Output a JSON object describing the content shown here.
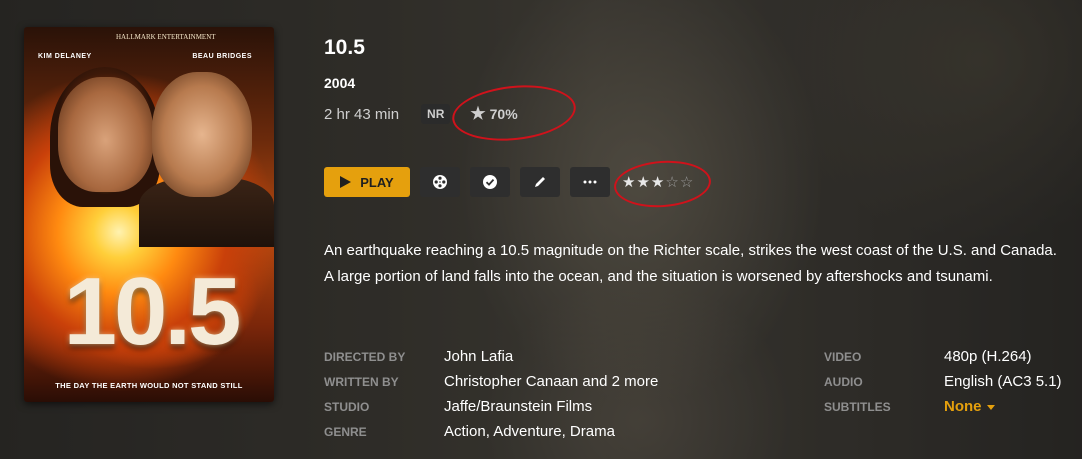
{
  "movie": {
    "title": "10.5",
    "year": "2004",
    "duration": "2 hr 43 min",
    "content_rating": "NR",
    "critic_rating": "70%",
    "user_rating_stars": 3,
    "user_rating_max": 5,
    "summary": "An earthquake reaching a 10.5 magnitude on the Richter scale, strikes the west coast of the U.S. and Canada. A large portion of land falls into the ocean, and the situation is worsened by aftershocks and tsunami."
  },
  "poster": {
    "studio": "HALLMARK ENTERTAINMENT",
    "actor_left": "KIM DELANEY",
    "actor_right": "BEAU BRIDGES",
    "title_art": "10.5",
    "tagline": "THE DAY THE EARTH WOULD NOT STAND STILL"
  },
  "actions": {
    "play_label": "PLAY",
    "icons": [
      "film-reel-icon",
      "checkmark-icon",
      "pencil-icon",
      "more-icon"
    ]
  },
  "details": {
    "left": [
      {
        "label": "DIRECTED BY",
        "value": "John Lafia"
      },
      {
        "label": "WRITTEN BY",
        "value": "Christopher Canaan and 2 more"
      },
      {
        "label": "STUDIO",
        "value": "Jaffe/Braunstein Films"
      },
      {
        "label": "GENRE",
        "value": "Action, Adventure, Drama"
      }
    ],
    "right": [
      {
        "label": "VIDEO",
        "value": "480p (H.264)"
      },
      {
        "label": "AUDIO",
        "value": "English (AC3 5.1)"
      },
      {
        "label": "SUBTITLES",
        "value": "None"
      }
    ]
  },
  "colors": {
    "accent": "#e5a00d",
    "annotation": "#d0121b"
  }
}
